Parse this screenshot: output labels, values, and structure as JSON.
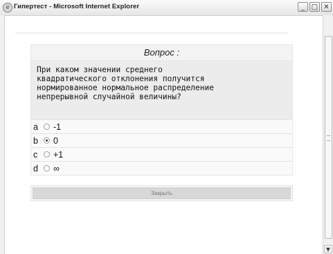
{
  "window": {
    "title": "Гипертест - Microsoft Internet Explorer",
    "controls": [
      "_",
      "□",
      "✕"
    ]
  },
  "question": {
    "header": "Вопрос :",
    "text": "При каком значении среднего\nквадратического отклонения получится\nнормированное нормальное распределение\nнепрерывной случайной величины?"
  },
  "answers": [
    {
      "letter": "a",
      "value": "-1",
      "selected": false
    },
    {
      "letter": "b",
      "value": "0",
      "selected": true
    },
    {
      "letter": "c",
      "value": "+1",
      "selected": false
    },
    {
      "letter": "d",
      "value": "∞",
      "selected": false
    }
  ],
  "close_button": "Закрыть",
  "icons": {
    "app": "ie-icon",
    "scroll_down": "scroll-down-icon"
  }
}
